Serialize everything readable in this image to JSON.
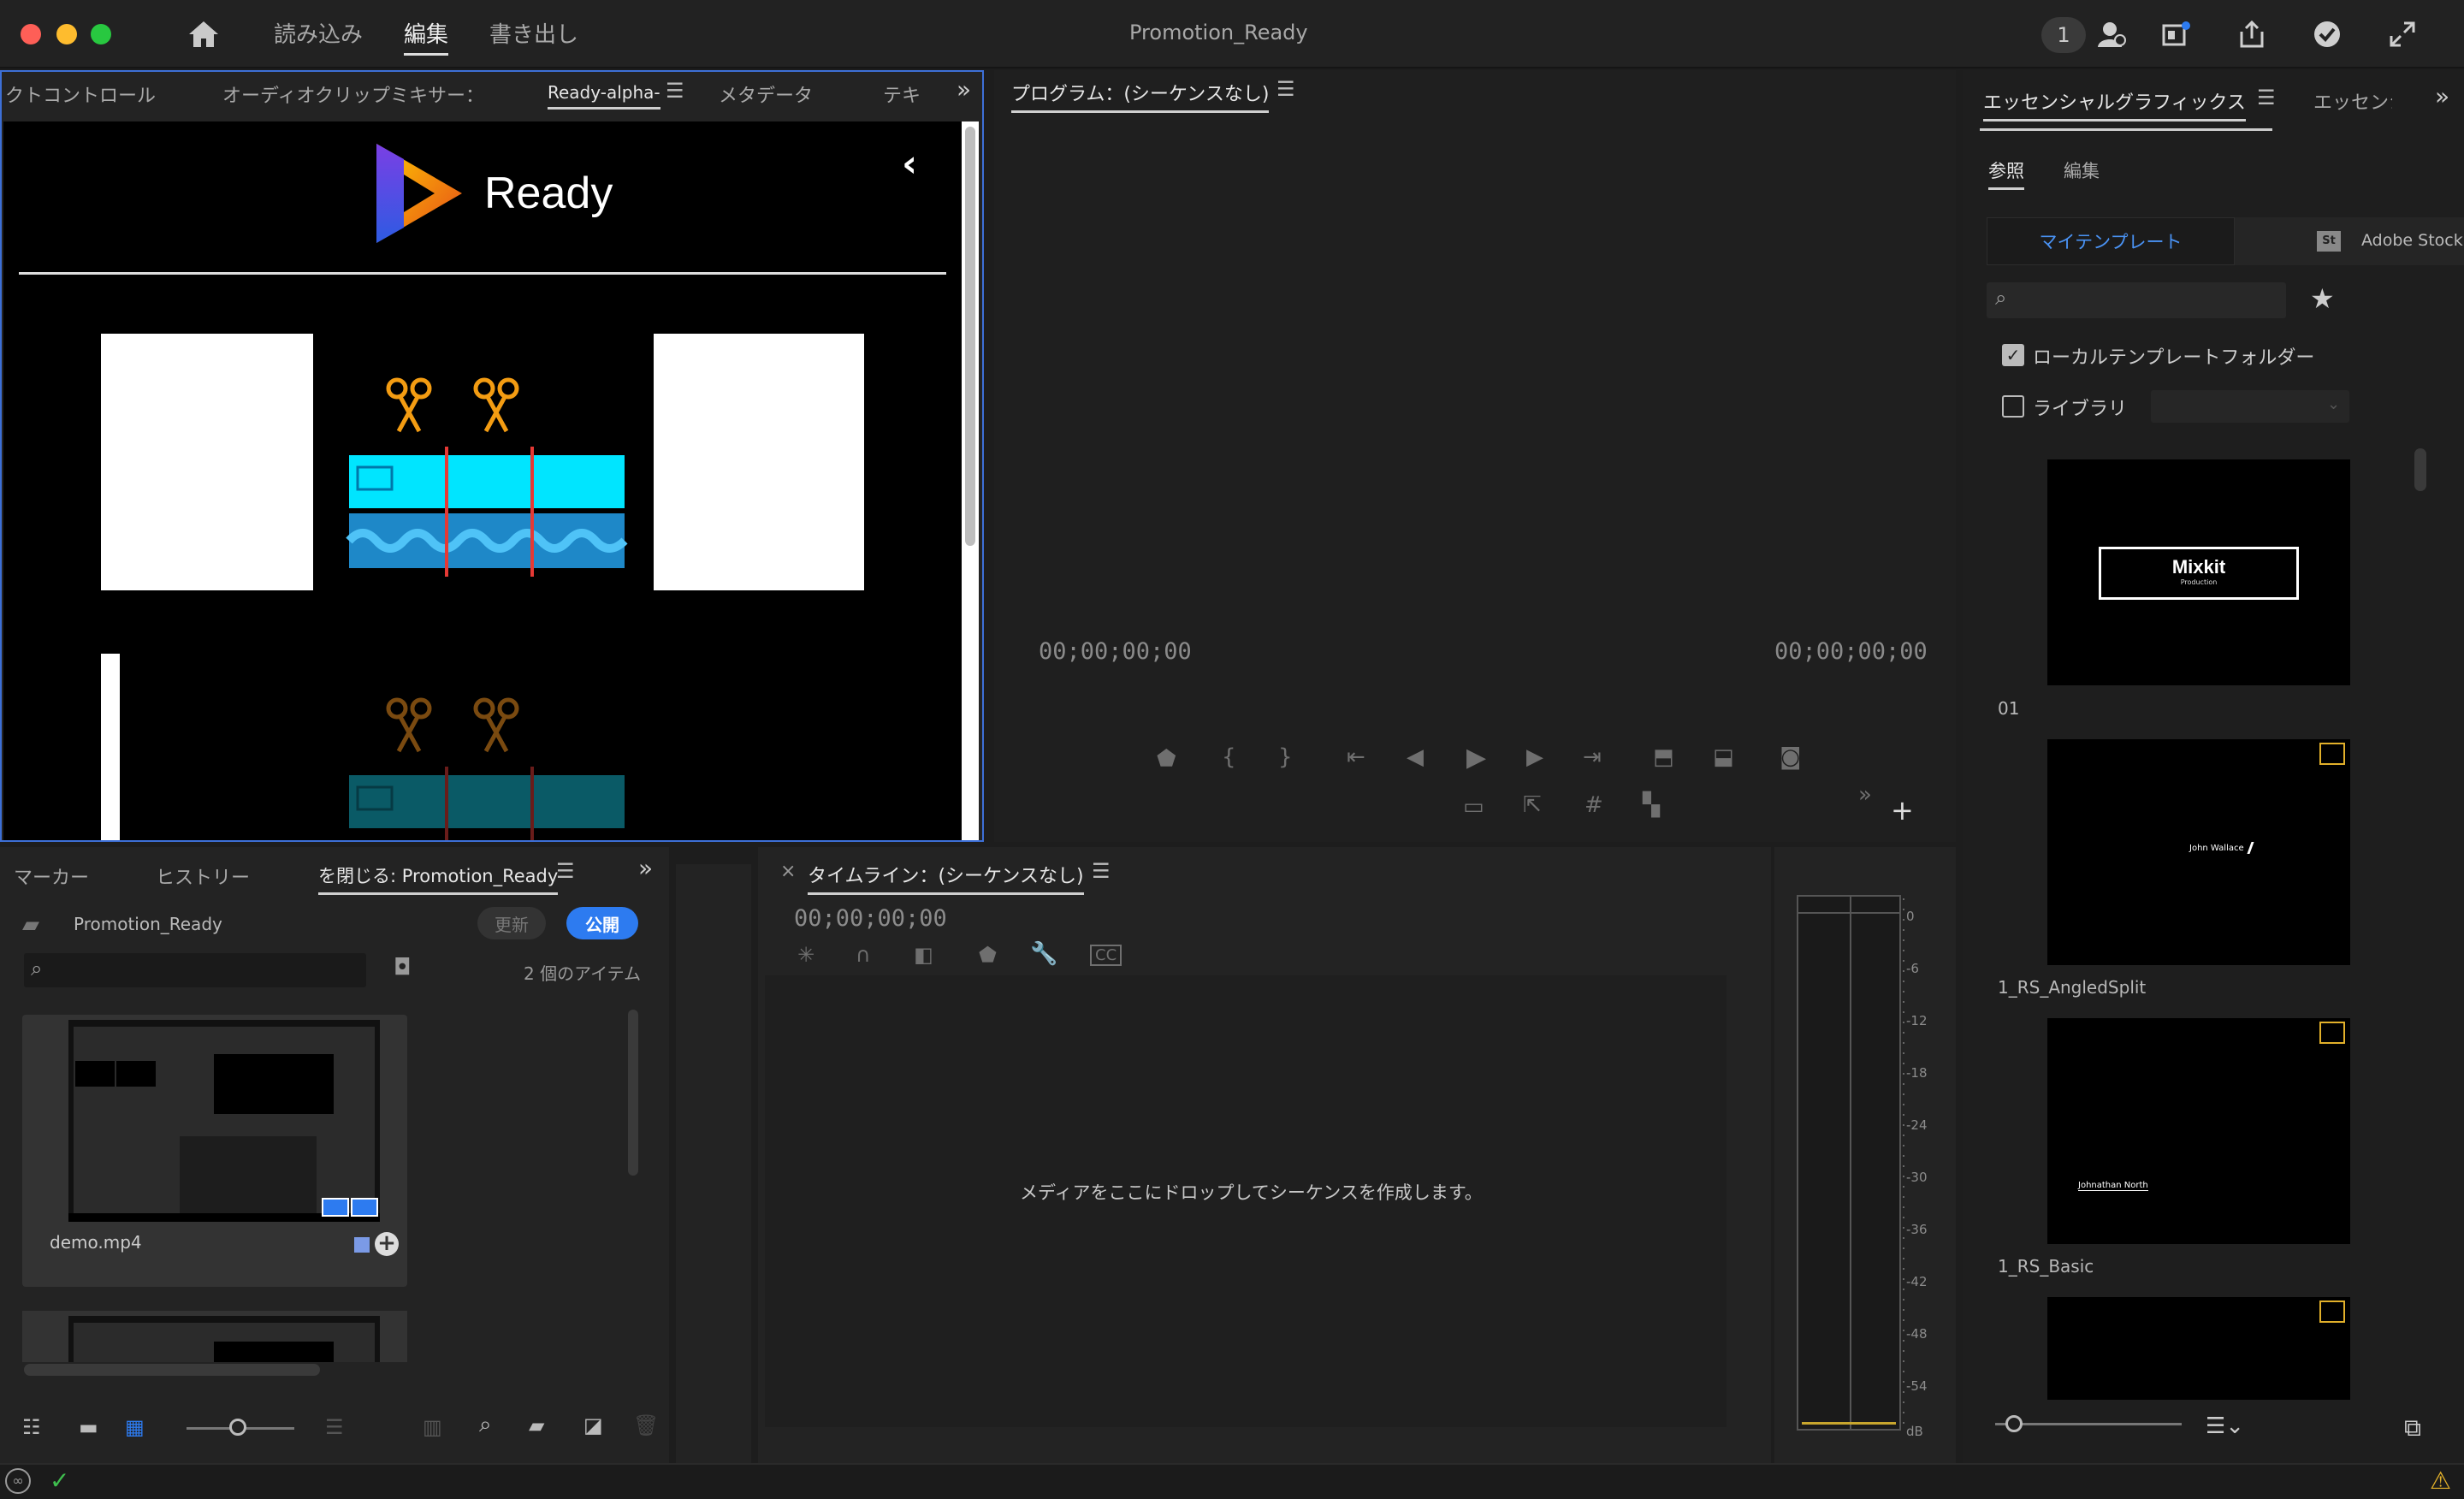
{
  "window": {
    "title": "Promotion_Ready"
  },
  "topnav": {
    "import": "読み込み",
    "edit": "編集",
    "export": "書き出し"
  },
  "topbar": {
    "counter": "1"
  },
  "source_panel": {
    "tabs": [
      "クトコントロール",
      "オーディオクリップミキサー：",
      "Ready-alpha-",
      "メタデータ",
      "テキ"
    ],
    "logo_text": "Ready"
  },
  "program_panel": {
    "title": "プログラム：(シーケンスなし)",
    "timecode_left": "00;00;00;00",
    "timecode_right": "00;00;00;00"
  },
  "project_panel": {
    "tabs": [
      "マーカー",
      "ヒストリー",
      "を閉じる: Promotion_Ready"
    ],
    "project_name": "Promotion_Ready",
    "update_button": "更新",
    "publish_button": "公開",
    "item_count": "2 個のアイテム",
    "clip_name": "demo.mp4"
  },
  "timeline_panel": {
    "title": "タイムライン：(シーケンスなし)",
    "timecode": "00;00;00;00",
    "drop_hint": "メディアをここにドロップしてシーケンスを作成します。"
  },
  "meter": {
    "labels": [
      "0",
      "-6",
      "-12",
      "-18",
      "-24",
      "-30",
      "-36",
      "-42",
      "-48",
      "-54",
      "dB"
    ]
  },
  "essential_graphics": {
    "tabs": [
      "エッセンシャルグラフィックス",
      "エッセンシ"
    ],
    "subtabs": [
      "参照",
      "編集"
    ],
    "source_tabs": [
      "マイテンプレート",
      "Adobe Stock"
    ],
    "stock_badge": "St",
    "local_folder": "ローカルテンプレートフォルダー",
    "library": "ライブラリ",
    "templates": [
      {
        "name": "01",
        "title": "Mixkit",
        "subtitle": "Production"
      },
      {
        "name": "1_RS_AngledSplit",
        "title": "John Wallace"
      },
      {
        "name": "1_RS_Basic",
        "title": "Johnathan North"
      },
      {
        "name": ""
      }
    ]
  },
  "colors": {
    "accent": "#2d7bf0",
    "cyan": "#00e5ff",
    "warning": "#e2b02a",
    "ok": "#3fbf4f"
  }
}
